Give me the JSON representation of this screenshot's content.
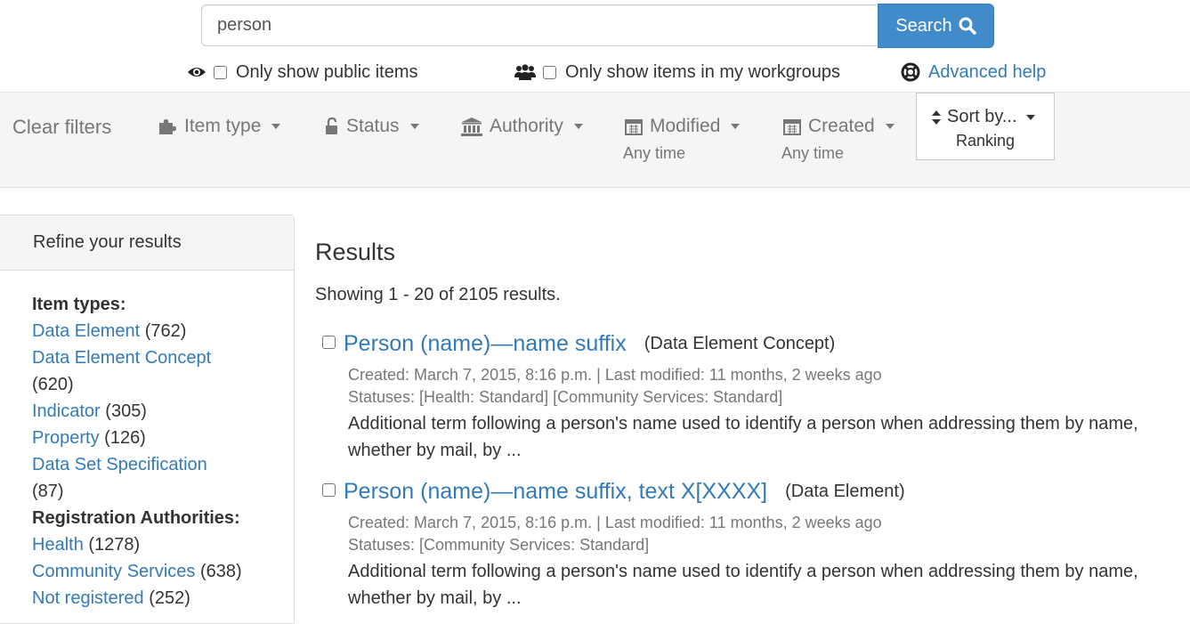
{
  "search": {
    "value": "person",
    "button_label": "Search"
  },
  "options": {
    "public_label": "Only show public items",
    "workgroups_label": "Only show items in my workgroups",
    "help_label": "Advanced help"
  },
  "filters": {
    "clear": "Clear filters",
    "item_type": "Item type",
    "status": "Status",
    "authority": "Authority",
    "modified": "Modified",
    "modified_sub": "Any time",
    "created": "Created",
    "created_sub": "Any time",
    "sort": "Sort by...",
    "sort_sub": "Ranking"
  },
  "sidebar": {
    "title": "Refine your results",
    "item_types_heading": "Item types:",
    "item_types": [
      {
        "label": "Data Element",
        "count": "(762)"
      },
      {
        "label": "Data Element Concept",
        "count": "(620)"
      },
      {
        "label": "Indicator",
        "count": "(305)"
      },
      {
        "label": "Property",
        "count": "(126)"
      },
      {
        "label": "Data Set Specification",
        "count": "(87)"
      }
    ],
    "authorities_heading": "Registration Authorities:",
    "authorities": [
      {
        "label": "Health",
        "count": "(1278)"
      },
      {
        "label": "Community Services",
        "count": "(638)"
      },
      {
        "label": "Not registered",
        "count": "(252)"
      }
    ]
  },
  "results": {
    "title": "Results",
    "count_text": "Showing 1 - 20 of 2105 results.",
    "items": [
      {
        "title": "Person (name)—name suffix",
        "type": "(Data Element Concept)",
        "meta": "Created: March 7, 2015, 8:16 p.m. | Last modified: 11 months, 2 weeks ago",
        "statuses": "Statuses: [Health: Standard] [Community Services: Standard]",
        "desc_line1": "Additional term following a person's name used to identify a person when addressing them by name,",
        "desc_line2": "whether by mail, by ..."
      },
      {
        "title": "Person (name)—name suffix, text X[XXXX]",
        "type": "(Data Element)",
        "meta": "Created: March 7, 2015, 8:16 p.m. | Last modified: 11 months, 2 weeks ago",
        "statuses": "Statuses: [Community Services: Standard]",
        "desc_line1": "Additional term following a person's name used to identify a person when addressing them by name,",
        "desc_line2": "whether by mail, by ..."
      }
    ]
  },
  "colors": {
    "link": "#337ab7",
    "search_button": "#428bca",
    "filter_bar": "#f5f5f5",
    "muted_text": "#777777"
  }
}
